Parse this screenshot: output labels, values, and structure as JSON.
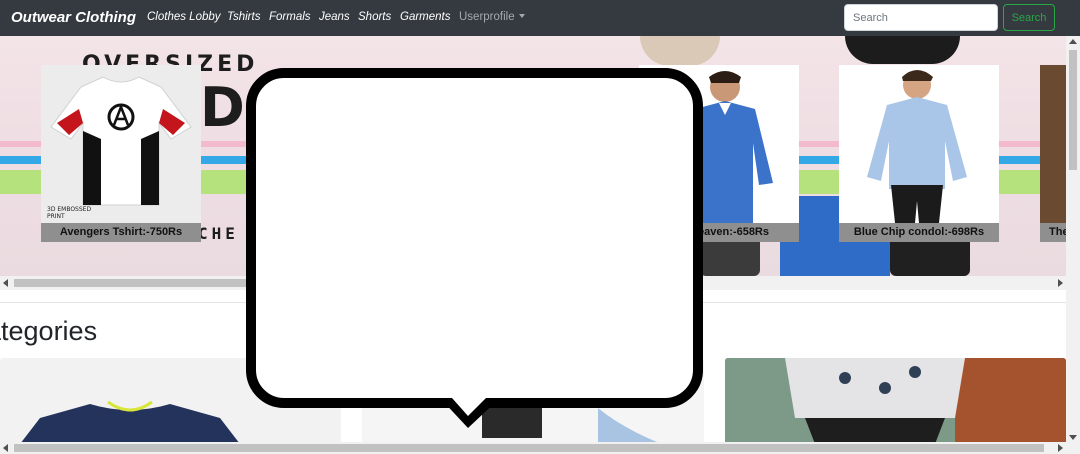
{
  "navbar": {
    "brand": "Outwear Clothing",
    "links": [
      "Clothes Lobby",
      "Tshirts",
      "Formals",
      "Jeans",
      "Shorts",
      "Garments"
    ],
    "user_menu": "Userprofile",
    "search_placeholder": "Search",
    "search_button": "Search"
  },
  "hero": {
    "banner_top_text": "OVERSIZED",
    "banner_big_text": "DS",
    "banner_bottom_text": "CHE",
    "products": [
      {
        "label": "Avengers Tshirt:-750Rs",
        "print_note": "3D EMBOSSED\nPRINT"
      },
      {
        "label": "heaven:-658Rs"
      },
      {
        "label": "Blue Chip condol:-698Rs"
      },
      {
        "label": "The"
      }
    ]
  },
  "categories": {
    "title": "Categories",
    "visible_title": "ategories"
  },
  "colors": {
    "navbar_bg": "#343a40",
    "search_green": "#28a745",
    "label_bg": "#8f8f8f"
  }
}
